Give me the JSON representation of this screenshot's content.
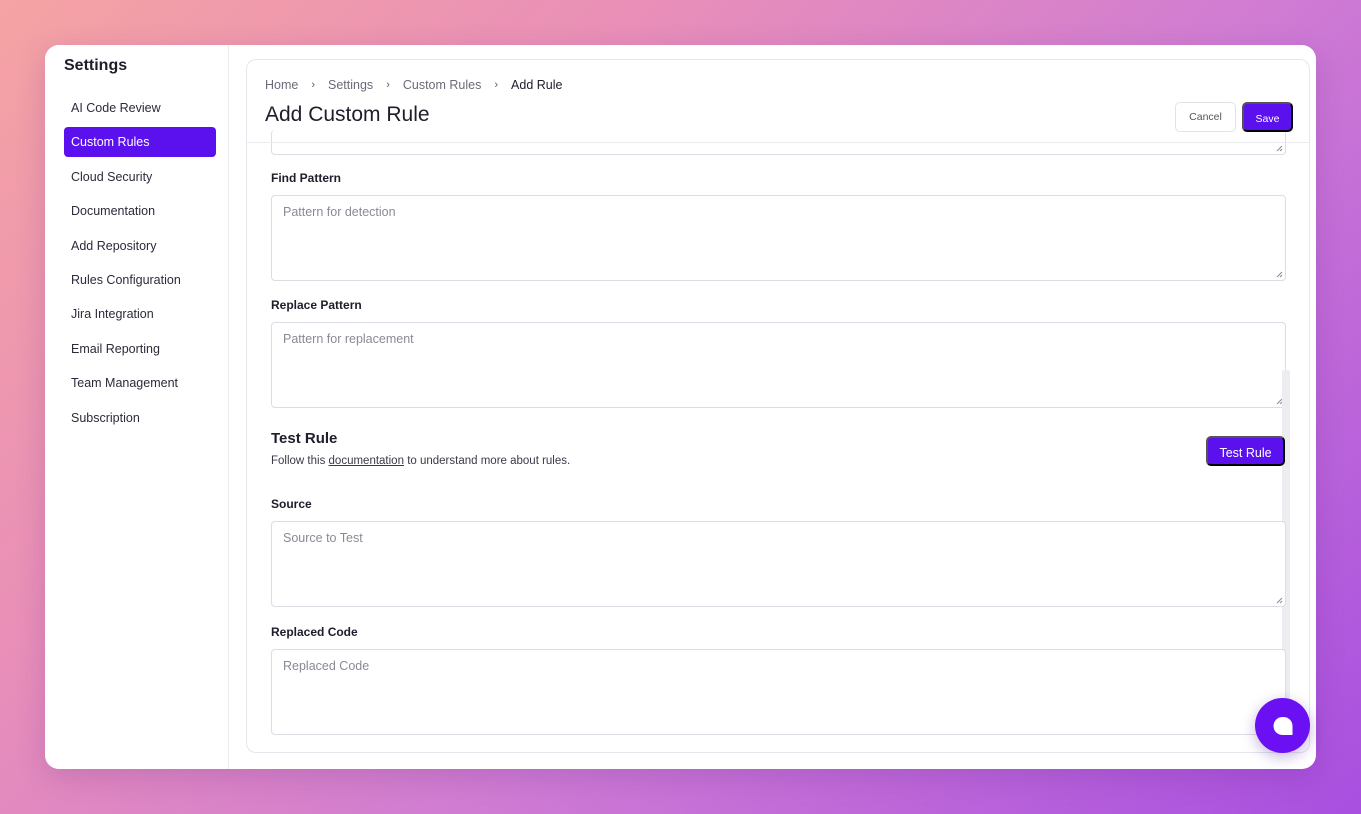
{
  "sidebar": {
    "title": "Settings",
    "items": [
      {
        "label": "AI Code Review"
      },
      {
        "label": "Custom Rules"
      },
      {
        "label": "Cloud Security"
      },
      {
        "label": "Documentation"
      },
      {
        "label": "Add Repository"
      },
      {
        "label": "Rules Configuration"
      },
      {
        "label": "Jira Integration"
      },
      {
        "label": "Email Reporting"
      },
      {
        "label": "Team Management"
      },
      {
        "label": "Subscription"
      }
    ],
    "active_item": "Custom Rules"
  },
  "breadcrumb": [
    "Home",
    "Settings",
    "Custom Rules",
    "Add Rule"
  ],
  "header": {
    "title": "Add Custom Rule",
    "cancel_label": "Cancel",
    "save_label": "Save"
  },
  "form": {
    "find_pattern": {
      "label": "Find Pattern",
      "placeholder": "Pattern for detection",
      "value": ""
    },
    "replace_pattern": {
      "label": "Replace Pattern",
      "placeholder": "Pattern for replacement",
      "value": ""
    }
  },
  "test_rule": {
    "title": "Test Rule",
    "desc_prefix": "Follow this",
    "link_text": "documentation",
    "desc_suffix": "to understand more about rules.",
    "button_label": "Test Rule",
    "source": {
      "label": "Source",
      "placeholder": "Source to Test",
      "value": ""
    },
    "replaced_code": {
      "label": "Replaced Code",
      "placeholder": "Replaced Code",
      "value": ""
    }
  },
  "colors": {
    "accent": "#5b10ee",
    "chat_bubble": "#6a10f2"
  },
  "icons": {
    "breadcrumb_separator": "chevron-right-icon",
    "textarea_resize": "resize-handle-icon",
    "chat": "chat-icon"
  }
}
